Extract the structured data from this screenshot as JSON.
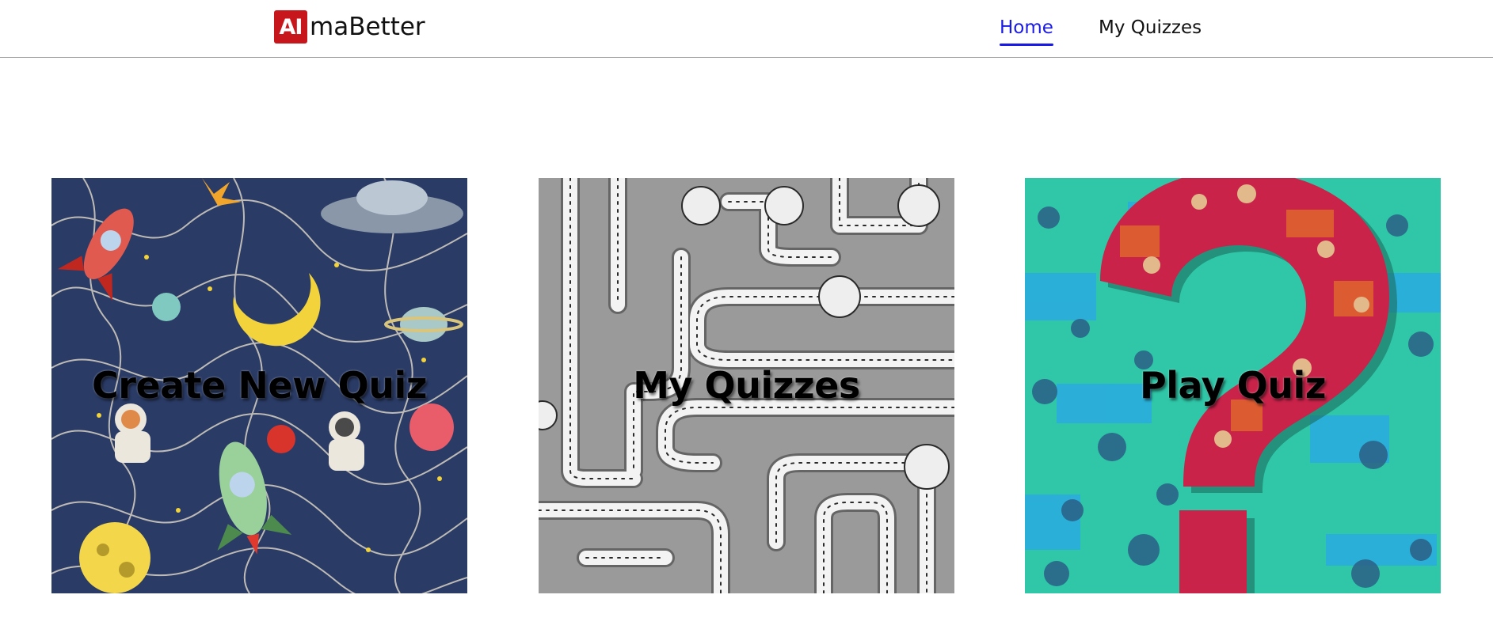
{
  "brand": {
    "badge": "AI",
    "name": "maBetter",
    "badge_color": "#c8161d"
  },
  "nav": {
    "items": [
      {
        "label": "Home",
        "active": true
      },
      {
        "label": "My Quizzes",
        "active": false
      }
    ],
    "active_color": "#1a1ae6"
  },
  "cards": [
    {
      "title": "Create New Quiz",
      "theme": "space-doodle",
      "background": "#2a3b66"
    },
    {
      "title": "My Quizzes",
      "theme": "rope-maze",
      "background": "#9a9a9a"
    },
    {
      "title": "Play Quiz",
      "theme": "question-mark",
      "background": "#2fc7a8"
    }
  ]
}
